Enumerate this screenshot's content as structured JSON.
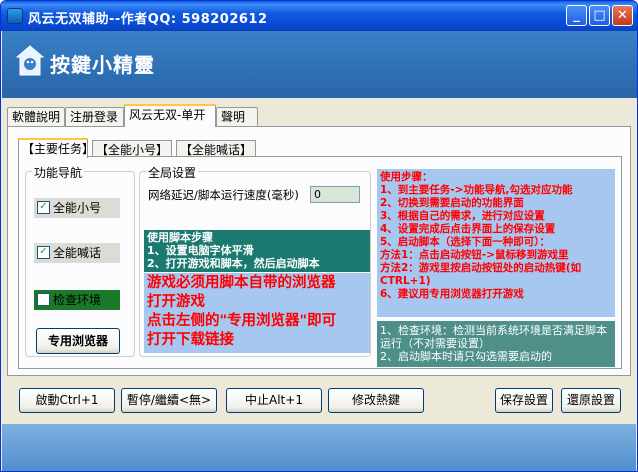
{
  "window": {
    "title": "风云无双辅助--作者QQ: 598202612",
    "min_glyph": "_",
    "max_glyph": "□",
    "close_glyph": "✕"
  },
  "header": {
    "logo_text": "按鍵小精靈"
  },
  "main_tabs": [
    "軟體說明",
    "注册登录",
    "风云无双-单开",
    "聲明"
  ],
  "sub_tabs": [
    "【主要任务】",
    "【全能小号】",
    "【全能喊话】"
  ],
  "nav_group": {
    "title": "功能导航",
    "items": [
      {
        "label": "全能小号",
        "checked": true,
        "check_glyph": "✓"
      },
      {
        "label": "全能喊话",
        "checked": true,
        "check_glyph": "✓"
      },
      {
        "label": "检查环境",
        "checked": false,
        "check_glyph": ""
      }
    ],
    "browser_button": "专用浏览器"
  },
  "global_group": {
    "title": "全局设置",
    "delay_label": "网络延迟/脚本运行速度(毫秒)",
    "delay_value": "0",
    "script_steps_title": "使用脚本步骤",
    "script_steps": [
      "1、设置电脑字体平滑",
      "2、打开游戏和脚本，然后启动脚本"
    ],
    "notice_lines": [
      "游戏必须用脚本自带的浏览器",
      "打开游戏",
      "点击左侧的\"专用浏览器\"即可",
      "打开下载链接"
    ]
  },
  "steps_panel": {
    "title": "使用步骤：",
    "lines": [
      "1、到主要任务->功能导航,勾选对应功能",
      "2、切换到需要启动的功能界面",
      "3、根据自己的需求，进行对应设置",
      "4、设置完成后点击界面上的保存设置",
      "5、启动脚本（选择下面一种即可）：",
      "方法1：点击启动按钮->鼠标移到游戏里",
      "方法2：游戏里按启动按钮处的启动热键(如CTRL+1)",
      "6、建议用专用浏览器打开游戏"
    ]
  },
  "info_panel": {
    "lines": [
      "1、检查环境：检测当前系统环境是否满足脚本运行（不对需要设置）",
      "2、启动脚本时请只勾选需要启动的"
    ]
  },
  "bottom_buttons": [
    "啟動Ctrl+1",
    "暫停/繼續<無>",
    "中止Alt+1",
    "修改熱鍵",
    "保存設置",
    "還原設置"
  ],
  "colors": {
    "red_text": "#ff0000",
    "steps_bg": "#a6c8f0",
    "teal_bg": "#1a7a70",
    "green_bg": "#1a7a2a",
    "info_bg": "#4e8f8a"
  }
}
